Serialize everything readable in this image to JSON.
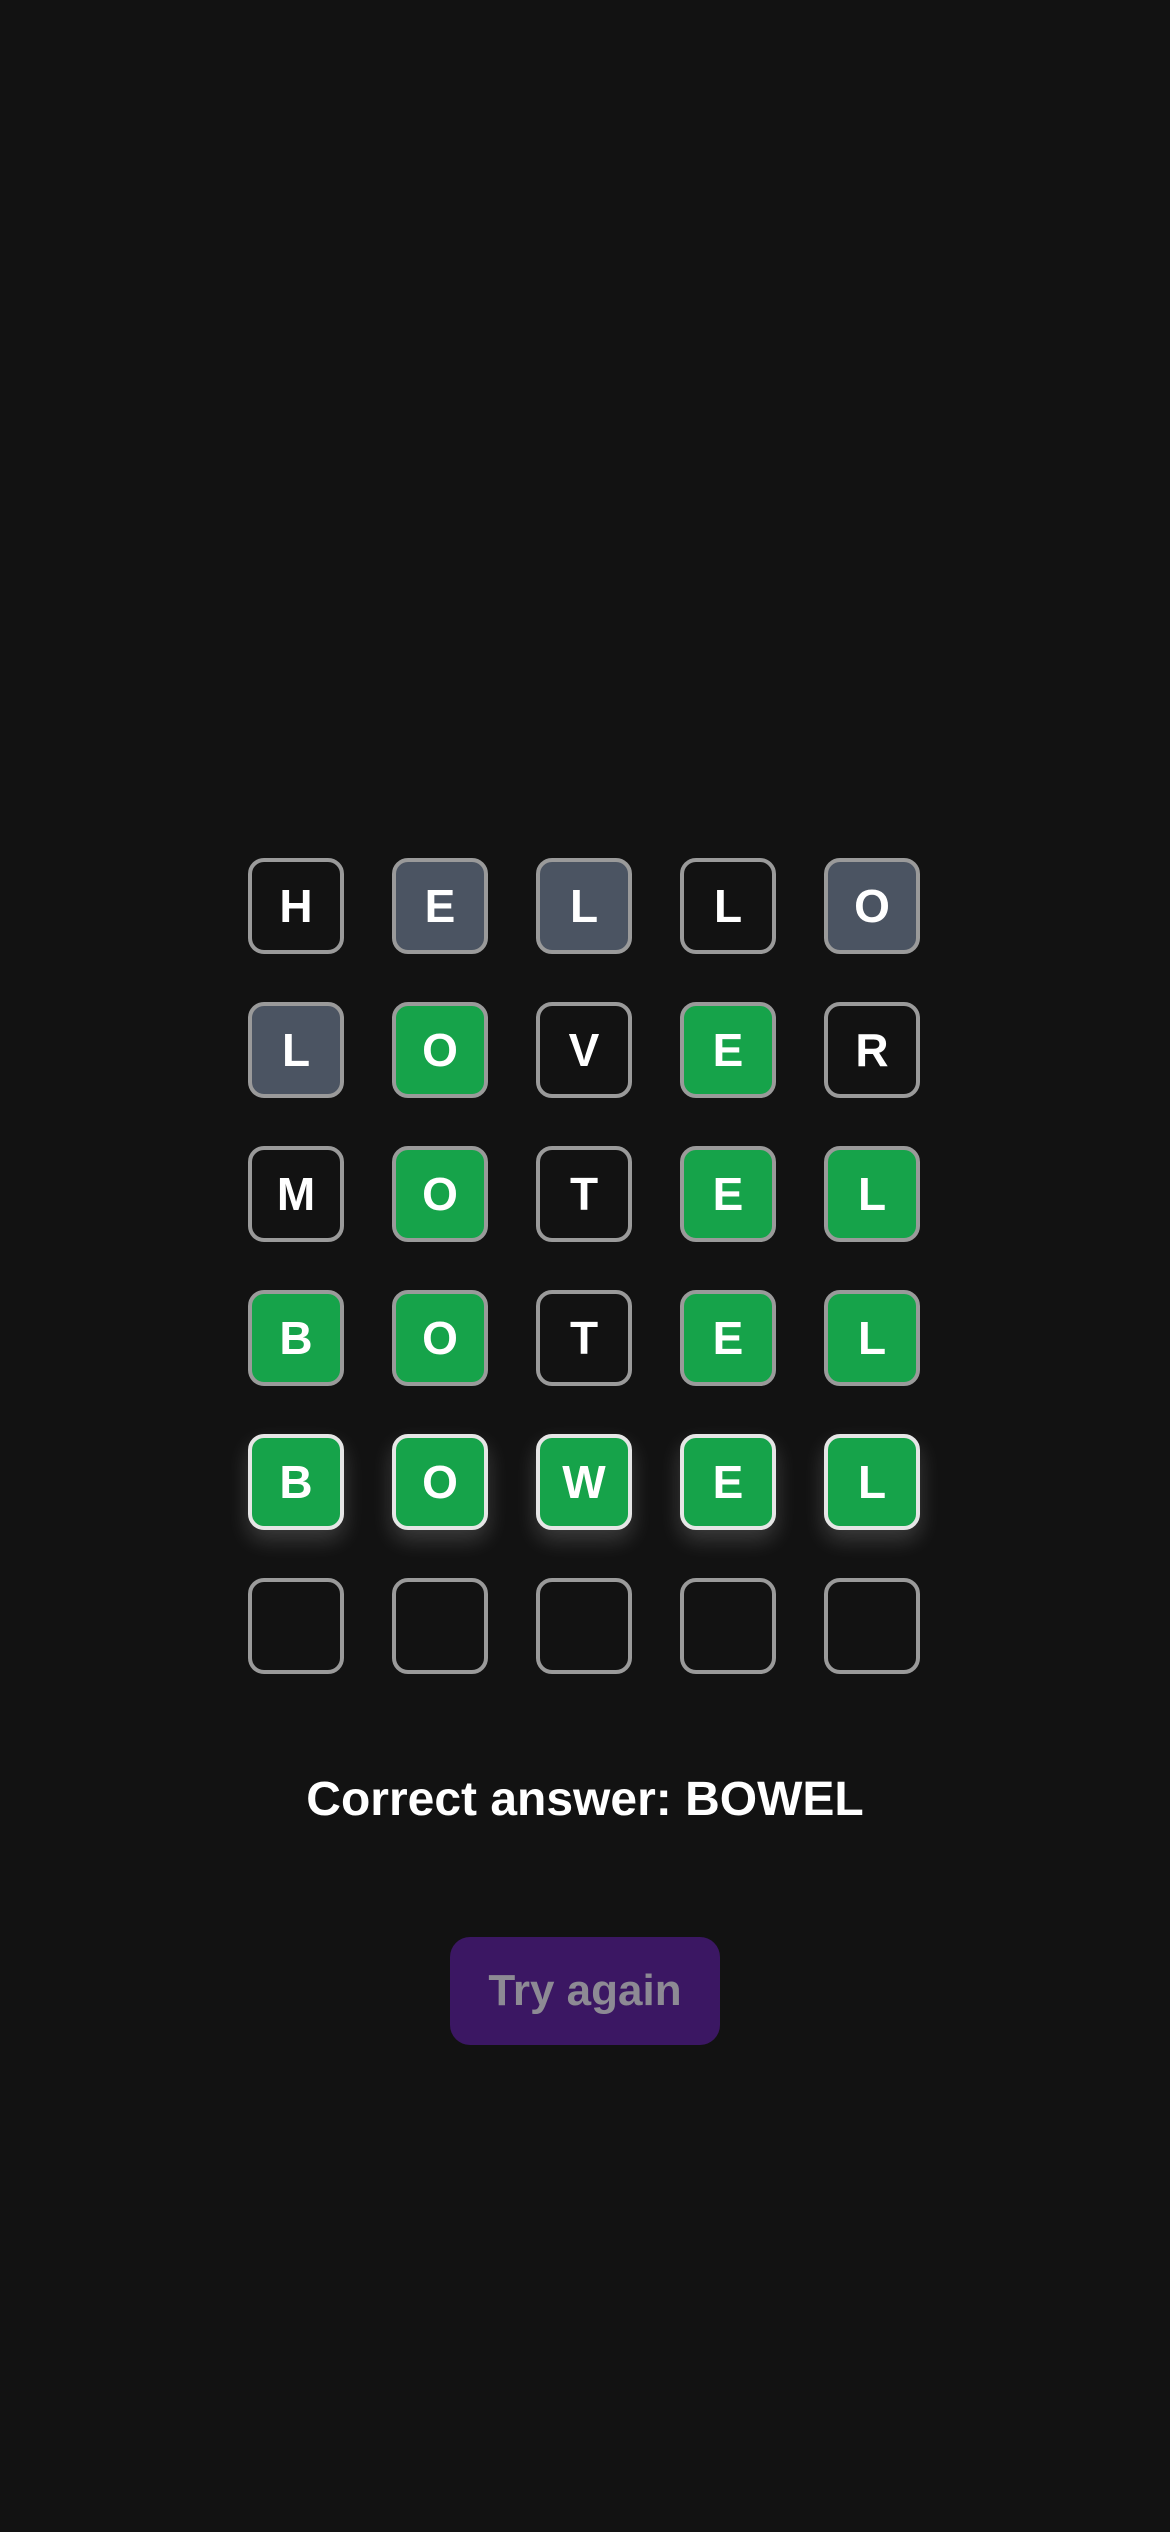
{
  "board": {
    "rows": [
      [
        {
          "letter": "H",
          "state": "default"
        },
        {
          "letter": "E",
          "state": "absent"
        },
        {
          "letter": "L",
          "state": "absent"
        },
        {
          "letter": "L",
          "state": "default"
        },
        {
          "letter": "O",
          "state": "absent"
        }
      ],
      [
        {
          "letter": "L",
          "state": "absent"
        },
        {
          "letter": "O",
          "state": "correct"
        },
        {
          "letter": "V",
          "state": "default"
        },
        {
          "letter": "E",
          "state": "correct"
        },
        {
          "letter": "R",
          "state": "default"
        }
      ],
      [
        {
          "letter": "M",
          "state": "default"
        },
        {
          "letter": "O",
          "state": "correct"
        },
        {
          "letter": "T",
          "state": "default"
        },
        {
          "letter": "E",
          "state": "correct"
        },
        {
          "letter": "L",
          "state": "correct"
        }
      ],
      [
        {
          "letter": "B",
          "state": "correct"
        },
        {
          "letter": "O",
          "state": "correct"
        },
        {
          "letter": "T",
          "state": "default"
        },
        {
          "letter": "E",
          "state": "correct"
        },
        {
          "letter": "L",
          "state": "correct"
        }
      ],
      [
        {
          "letter": "B",
          "state": "correct",
          "highlight": true
        },
        {
          "letter": "O",
          "state": "correct",
          "highlight": true
        },
        {
          "letter": "W",
          "state": "correct",
          "highlight": true
        },
        {
          "letter": "E",
          "state": "correct",
          "highlight": true
        },
        {
          "letter": "L",
          "state": "correct",
          "highlight": true
        }
      ],
      [
        {
          "letter": "",
          "state": "empty"
        },
        {
          "letter": "",
          "state": "empty"
        },
        {
          "letter": "",
          "state": "empty"
        },
        {
          "letter": "",
          "state": "empty"
        },
        {
          "letter": "",
          "state": "empty"
        }
      ]
    ]
  },
  "result": {
    "correct_answer_text": "Correct answer: BOWEL"
  },
  "actions": {
    "try_again_label": "Try again"
  },
  "colors": {
    "background": "#121212",
    "correct": "#16a34a",
    "absent": "#4b5462",
    "button": "#3b1763"
  }
}
